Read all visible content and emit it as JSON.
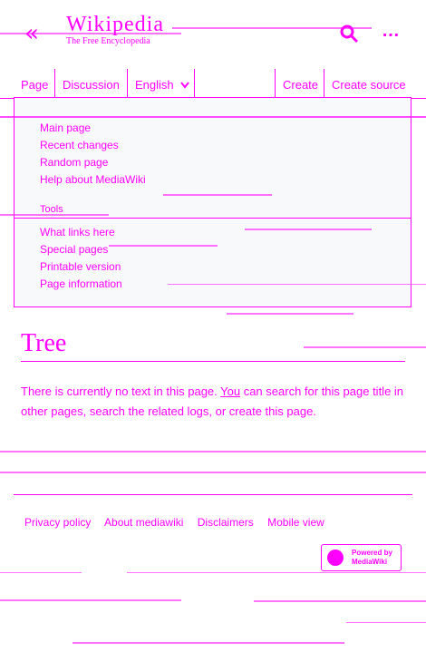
{
  "header": {
    "wordmark": "Wikipedia",
    "tagline": "The Free Encyclopedia"
  },
  "tabs": {
    "page": "Page",
    "discussion": "Discussion",
    "language": "English",
    "create": "Create",
    "create_source": "Create source"
  },
  "menu": {
    "nav": [
      "Main page",
      "Recent changes",
      "Random page",
      "Help about MediaWiki"
    ],
    "tools_heading": "Tools",
    "tools": [
      "What links here",
      "Special pages",
      "Printable version",
      "Page information"
    ]
  },
  "content": {
    "title": "Tree",
    "notice_a": "There is currently no text in this page. ",
    "notice_you": "You",
    "notice_b": " can search for this page title in other pages, search the related logs, or create this page."
  },
  "footer": {
    "links": [
      "Privacy policy",
      "About mediawiki",
      "Disclaimers",
      "Mobile view"
    ],
    "powered_line1": "Powered by",
    "powered_line2": "MediaWiki"
  }
}
